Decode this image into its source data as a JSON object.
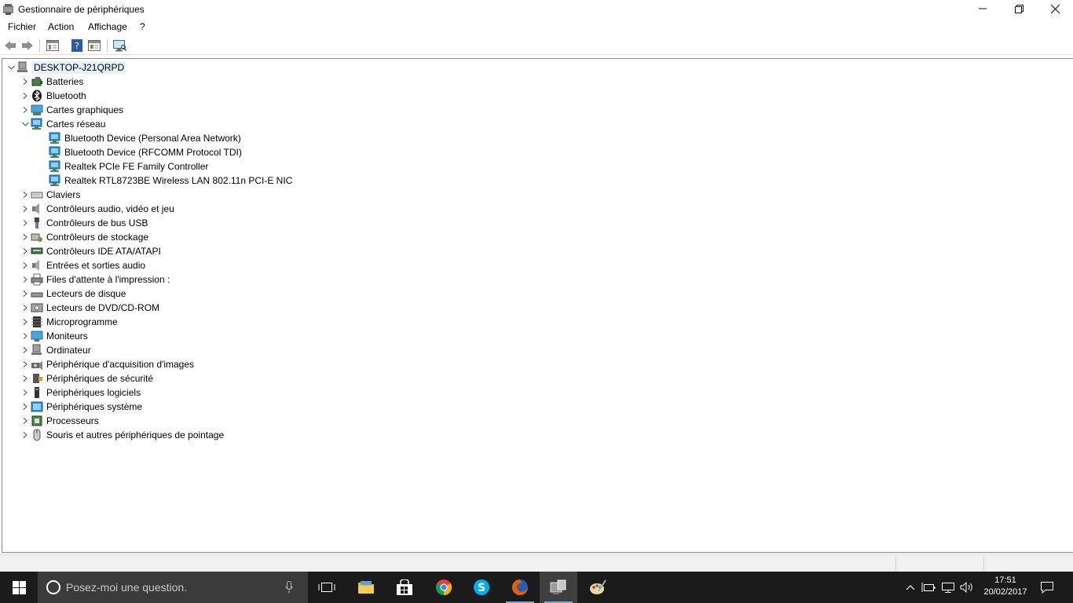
{
  "window": {
    "title": "Gestionnaire de périphériques",
    "icon": "device-manager-icon",
    "buttons": {
      "minimize": "—",
      "maximize": "❐",
      "close": "✕"
    }
  },
  "menu": {
    "items": [
      "Fichier",
      "Action",
      "Affichage",
      "?"
    ]
  },
  "toolbar": {
    "buttons": [
      "back-arrow-icon",
      "forward-arrow-icon",
      "properties-icon",
      "help-icon",
      "update-driver-icon",
      "scan-hardware-icon"
    ]
  },
  "tree": {
    "root": {
      "label": "DESKTOP-J21QRPD",
      "icon": "computer-icon",
      "expanded": true
    },
    "categories": [
      {
        "label": "Batteries",
        "icon": "battery-icon",
        "expanded": false
      },
      {
        "label": "Bluetooth",
        "icon": "bluetooth-icon",
        "expanded": false
      },
      {
        "label": "Cartes graphiques",
        "icon": "display-adapter-icon",
        "expanded": false
      },
      {
        "label": "Cartes réseau",
        "icon": "network-adapter-icon",
        "expanded": true,
        "children": [
          {
            "label": "Bluetooth Device (Personal Area Network)",
            "icon": "network-adapter-icon"
          },
          {
            "label": "Bluetooth Device (RFCOMM Protocol TDI)",
            "icon": "network-adapter-icon"
          },
          {
            "label": "Realtek PCIe FE Family Controller",
            "icon": "network-adapter-icon"
          },
          {
            "label": "Realtek RTL8723BE Wireless LAN 802.11n PCI-E NIC",
            "icon": "network-adapter-icon"
          }
        ]
      },
      {
        "label": "Claviers",
        "icon": "keyboard-icon",
        "expanded": false
      },
      {
        "label": "Contrôleurs audio, vidéo et jeu",
        "icon": "speaker-icon",
        "expanded": false
      },
      {
        "label": "Contrôleurs de bus USB",
        "icon": "usb-icon",
        "expanded": false
      },
      {
        "label": "Contrôleurs de stockage",
        "icon": "storage-controller-icon",
        "expanded": false
      },
      {
        "label": "Contrôleurs IDE ATA/ATAPI",
        "icon": "ide-controller-icon",
        "expanded": false
      },
      {
        "label": "Entrées et sorties audio",
        "icon": "audio-io-icon",
        "expanded": false
      },
      {
        "label": "Files d'attente à l'impression :",
        "icon": "printer-icon",
        "expanded": false
      },
      {
        "label": "Lecteurs de disque",
        "icon": "disk-drive-icon",
        "expanded": false
      },
      {
        "label": "Lecteurs de DVD/CD-ROM",
        "icon": "dvd-drive-icon",
        "expanded": false
      },
      {
        "label": "Microprogramme",
        "icon": "firmware-icon",
        "expanded": false
      },
      {
        "label": "Moniteurs",
        "icon": "monitor-icon",
        "expanded": false
      },
      {
        "label": "Ordinateur",
        "icon": "computer-icon",
        "expanded": false
      },
      {
        "label": "Périphérique d'acquisition d'images",
        "icon": "camera-icon",
        "expanded": false
      },
      {
        "label": "Périphériques de sécurité",
        "icon": "security-device-icon",
        "expanded": false
      },
      {
        "label": "Périphériques logiciels",
        "icon": "software-device-icon",
        "expanded": false
      },
      {
        "label": "Périphériques système",
        "icon": "system-device-icon",
        "expanded": false
      },
      {
        "label": "Processeurs",
        "icon": "processor-icon",
        "expanded": false
      },
      {
        "label": "Souris et autres périphériques de pointage",
        "icon": "mouse-icon",
        "expanded": false
      }
    ]
  },
  "taskbar": {
    "search_placeholder": "Posez-moi une question.",
    "apps": [
      "task-view-icon",
      "file-explorer-icon",
      "store-icon",
      "chrome-icon",
      "skype-icon",
      "firefox-icon",
      "device-manager-icon",
      "paint-icon"
    ],
    "tray": [
      "chevron-up-icon",
      "battery-icon",
      "network-icon",
      "volume-icon"
    ],
    "time": "17:51",
    "date": "20/02/2017"
  },
  "colors": {
    "selection": "#e5f1fb",
    "taskbar": "#1b1b1b",
    "search_box": "#3b3b3b",
    "network_icon": "#2e8bd6"
  }
}
